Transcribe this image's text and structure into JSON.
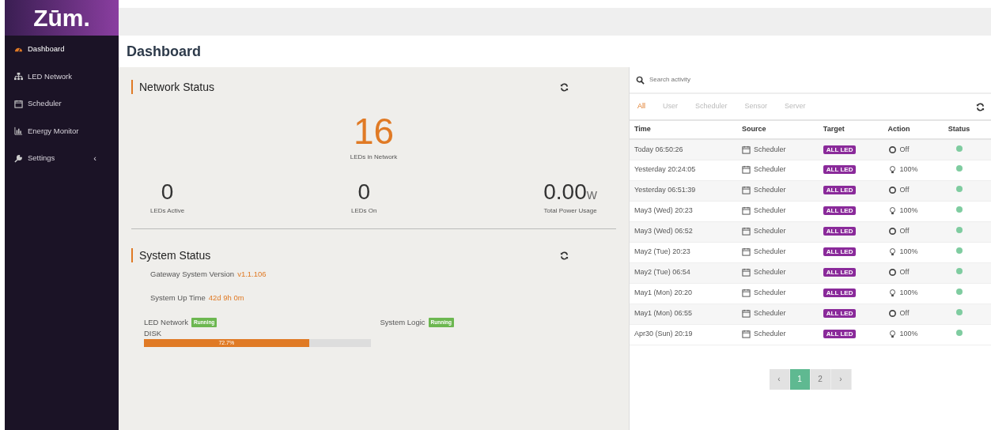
{
  "logo": "Zūm.",
  "sidebar": {
    "items": [
      {
        "label": "Dashboard",
        "selected": true
      },
      {
        "label": "LED Network",
        "selected": false
      },
      {
        "label": "Scheduler",
        "selected": false
      },
      {
        "label": "Energy Monitor",
        "selected": false
      },
      {
        "label": "Settings",
        "selected": false,
        "caret": "‹"
      }
    ]
  },
  "page_title": "Dashboard",
  "network_status": {
    "title": "Network Status",
    "main": {
      "value": "16",
      "label": "LEDs in Network"
    },
    "stats": [
      {
        "value": "0",
        "label": "LEDs Active"
      },
      {
        "value": "0",
        "label": "LEDs On"
      },
      {
        "value": "0.00",
        "unit": "W",
        "label": "Total Power Usage"
      }
    ]
  },
  "system_status": {
    "title": "System Status",
    "version_label": "Gateway System Version",
    "version": "v1.1.106",
    "uptime_label": "System Up Time",
    "uptime": "42d 9h 0m",
    "services": [
      {
        "name": "LED Network",
        "badge": "Running"
      },
      {
        "name": "System Logic",
        "badge": "Running"
      }
    ],
    "disk": {
      "label": "DISK",
      "level": 0.727,
      "reading": "72.7%"
    }
  },
  "activity": {
    "search": {
      "placeholder": "Search activity"
    },
    "filters": [
      {
        "label": "All",
        "selected": true
      },
      {
        "label": "User",
        "selected": false
      },
      {
        "label": "Scheduler",
        "selected": false
      },
      {
        "label": "Sensor",
        "selected": false
      },
      {
        "label": "Server",
        "selected": false
      }
    ],
    "table": {
      "columns": [
        "Time",
        "Source",
        "Target",
        "Action",
        "Status"
      ],
      "rows": [
        {
          "time": "Today 06:50:26",
          "source": "Scheduler",
          "target": "ALL LED",
          "action": "Off",
          "kind": "off",
          "color": "#7fcca0"
        },
        {
          "time": "Yesterday 20:24:05",
          "source": "Scheduler",
          "target": "ALL LED",
          "action": "100%",
          "kind": "on",
          "color": "#7fcca0"
        },
        {
          "time": "Yesterday 06:51:39",
          "source": "Scheduler",
          "target": "ALL LED",
          "action": "Off",
          "kind": "off",
          "color": "#7fcca0"
        },
        {
          "time": "May3 (Wed) 20:23",
          "source": "Scheduler",
          "target": "ALL LED",
          "action": "100%",
          "kind": "on",
          "color": "#7fcca0"
        },
        {
          "time": "May3 (Wed) 06:52",
          "source": "Scheduler",
          "target": "ALL LED",
          "action": "Off",
          "kind": "off",
          "color": "#7fcca0"
        },
        {
          "time": "May2 (Tue) 20:23",
          "source": "Scheduler",
          "target": "ALL LED",
          "action": "100%",
          "kind": "on",
          "color": "#7fcca0"
        },
        {
          "time": "May2 (Tue) 06:54",
          "source": "Scheduler",
          "target": "ALL LED",
          "action": "Off",
          "kind": "off",
          "color": "#7fcca0"
        },
        {
          "time": "May1 (Mon) 20:20",
          "source": "Scheduler",
          "target": "ALL LED",
          "action": "100%",
          "kind": "on",
          "color": "#7fcca0"
        },
        {
          "time": "May1 (Mon) 06:55",
          "source": "Scheduler",
          "target": "ALL LED",
          "action": "Off",
          "kind": "off",
          "color": "#7fcca0"
        },
        {
          "time": "Apr30 (Sun) 20:19",
          "source": "Scheduler",
          "target": "ALL LED",
          "action": "100%",
          "kind": "on",
          "color": "#7fcca0"
        }
      ]
    },
    "pagination": [
      {
        "label": "‹",
        "selected": false
      },
      {
        "label": "1",
        "selected": true
      },
      {
        "label": "2",
        "selected": false
      },
      {
        "label": "›",
        "selected": false
      }
    ]
  }
}
